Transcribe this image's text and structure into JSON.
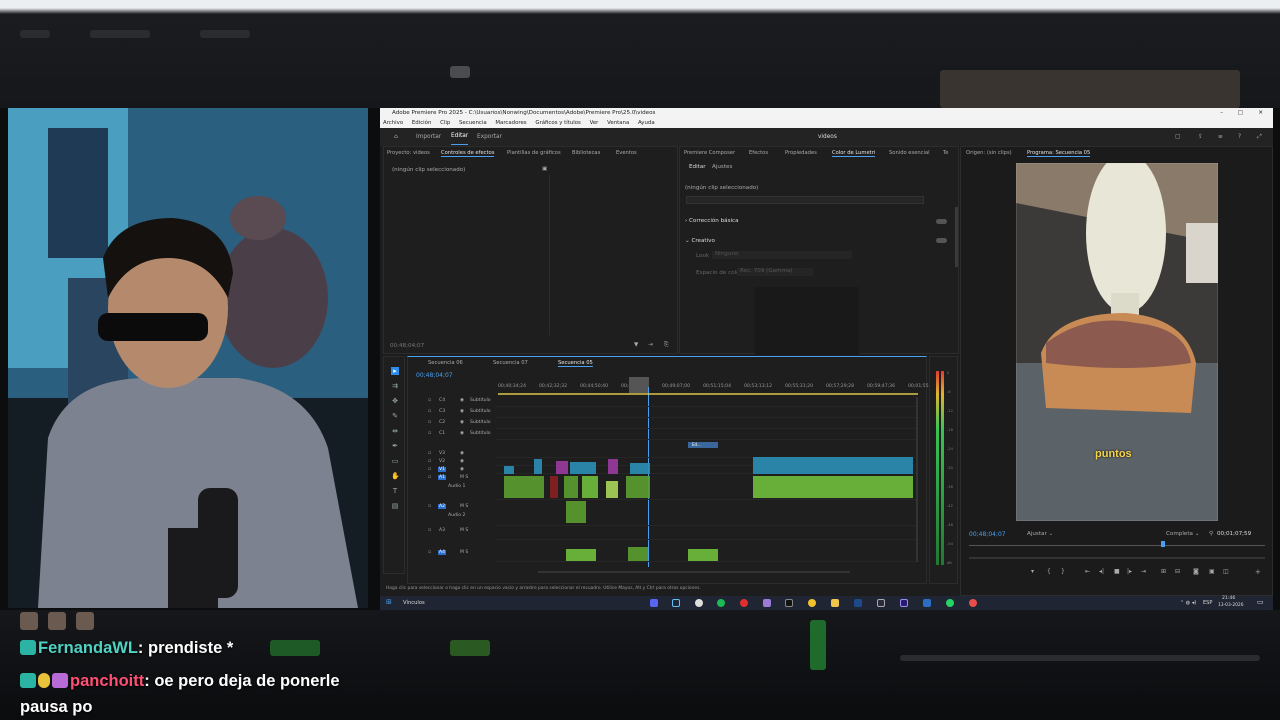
{
  "premiere": {
    "window_title": "Adobe Premiere Pro 2025 - C:\\Usuarios\\Nonwing\\Documentos\\Adobe\\Premiere Pro\\25.0\\videos",
    "menu": [
      "Archivo",
      "Edición",
      "Clip",
      "Secuencia",
      "Marcadores",
      "Gráficos y títulos",
      "Ver",
      "Ventana",
      "Ayuda"
    ],
    "nav_tabs": {
      "importar": "Importar",
      "editar": "Editar",
      "exportar": "Exportar"
    },
    "project_name": "videos",
    "left_tabs": [
      "Proyecto: videos",
      "Controles de efectos",
      "Plantillas de gráficos",
      "Bibliotecas",
      "Eventos"
    ],
    "no_clip": "(ningún clip seleccionado)",
    "left_timecode": "00;48;04;07",
    "mid_tabs": [
      "Premiere Composer",
      "Efectos",
      "Propiedades",
      "Color de Lumetri",
      "Sonido esencial",
      "Te"
    ],
    "lumetri_subtabs": {
      "editar": "Editar",
      "ajustes": "Ajustes"
    },
    "lumetri_no_clip": "(ningún clip seleccionado)",
    "correccion": "Corrección básica",
    "creativo": "Creativo",
    "look_label": "Look",
    "look_value": "Ninguno",
    "espacio_label": "Espacio de color",
    "espacio_value": "Rec. 709 (Gamma)",
    "monitor_tabs": {
      "origen": "Origen: (sin clips)",
      "programa": "Programa: Secuencia 05"
    },
    "video_caption": "puntos",
    "monitor_timecode": "00;48;04;07",
    "fit_label": "Ajustar",
    "quality_label": "Completa",
    "duration": "00;01;07;59",
    "seq_tabs": [
      "Secuencia 06",
      "Secuencia 07",
      "Secuencia 05"
    ],
    "seq_timecode": "00;48;04;07",
    "ruler": [
      "00;40;34;24",
      "00;42;32;32",
      "00;44;50;40",
      "00;46;48;48",
      "00;49;07;00",
      "00;51;15;04",
      "00;53;13;12",
      "00;55;31;20",
      "00;57;29;28",
      "00;59;47;36",
      "00;01;55;4"
    ],
    "tracks": [
      {
        "id": "C4",
        "name": "Subtítulo"
      },
      {
        "id": "C3",
        "name": "Subtítulo"
      },
      {
        "id": "C2",
        "name": "Subtítulo"
      },
      {
        "id": "C1",
        "name": "Subtítulo"
      },
      {
        "id": "V3",
        "name": ""
      },
      {
        "id": "V2",
        "name": ""
      },
      {
        "id": "V1",
        "name": ""
      },
      {
        "id": "A1",
        "name": "Audio 1"
      },
      {
        "id": "A2",
        "name": "Audio 2"
      },
      {
        "id": "A3",
        "name": ""
      },
      {
        "id": "A4",
        "name": ""
      }
    ],
    "small_clip": "Ed...",
    "status": "Haga clic para seleccionar o haga clic en un espacio vacío y arrastre para seleccionar el recuadro. Utilice Mayús, Alt y Ctrl para otras opciones.",
    "taskbar": {
      "vinculos": "Vínculos",
      "lang": "ESP",
      "time": "21:46",
      "date": "13-03-2026"
    },
    "meter_scale": [
      "0",
      "-6",
      "-12",
      "-18",
      "-24",
      "-30",
      "-36",
      "-42",
      "-48",
      "-54",
      "dB"
    ]
  },
  "chat": [
    {
      "user": "FernandaWL",
      "msg": "prendiste *",
      "color": "#4fd3c4"
    },
    {
      "user": "panchoitt",
      "msg": "oe pero deja de ponerle pausa po",
      "color": "#ff4f74"
    }
  ],
  "colors": {
    "accent": "#2d8ceb",
    "audio_clip": "#6fbf3b",
    "video_clip": "#2b8fb7",
    "caption": "#f5d548"
  }
}
